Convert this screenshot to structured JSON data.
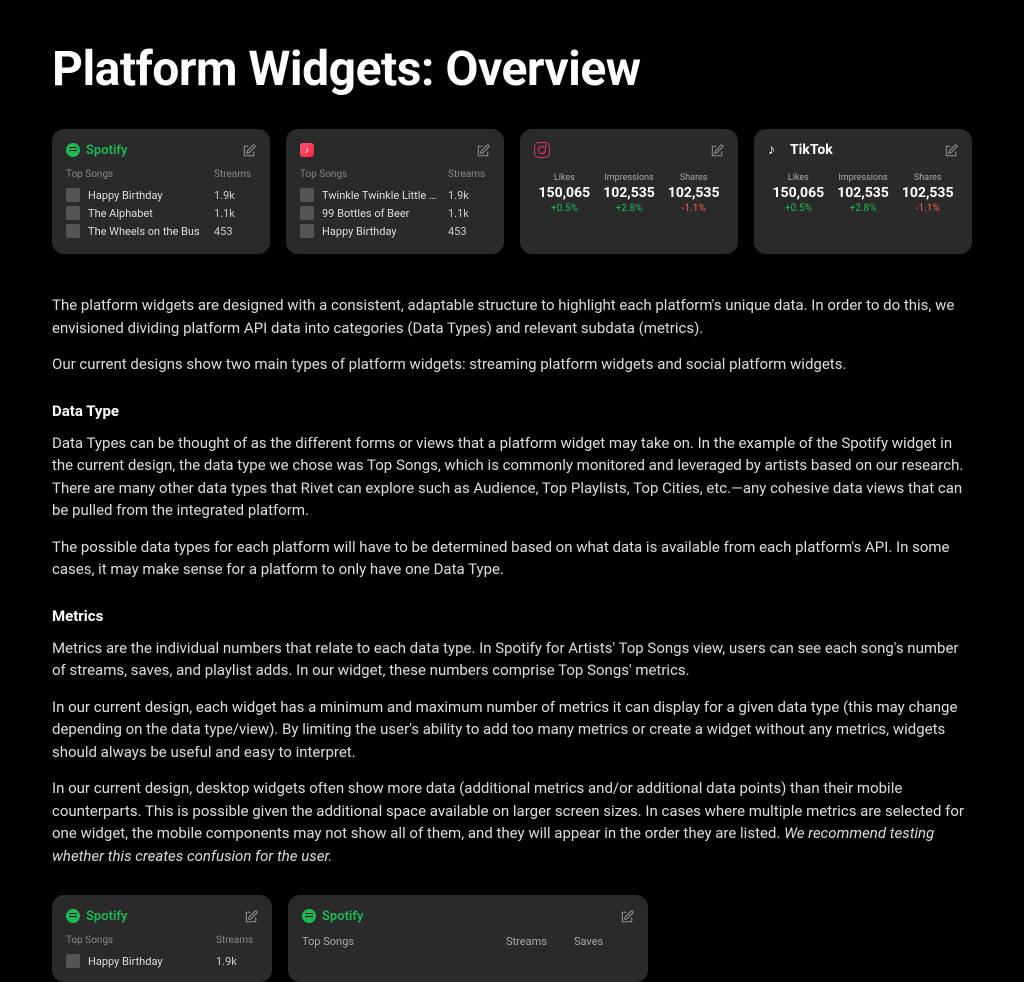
{
  "title": "Platform Widgets: Overview",
  "widgets": {
    "spotify": {
      "brand": "Spotify",
      "col_label": "Top Songs",
      "col_metric": "Streams",
      "songs": [
        {
          "name": "Happy Birthday",
          "value": "1.9k"
        },
        {
          "name": "The Alphabet",
          "value": "1.1k"
        },
        {
          "name": "The Wheels on the Bus",
          "value": "453"
        }
      ]
    },
    "apple": {
      "col_label": "Top Songs",
      "col_metric": "Streams",
      "songs": [
        {
          "name": "Twinkle Twinkle Little Star",
          "value": "1.9k"
        },
        {
          "name": "99 Bottles of Beer",
          "value": "1.1k"
        },
        {
          "name": "Happy Birthday",
          "value": "453"
        }
      ]
    },
    "instagram": {
      "metrics": [
        {
          "label": "Likes",
          "value": "150,065",
          "delta": "+0.5%",
          "dir": "pos"
        },
        {
          "label": "Impressions",
          "value": "102,535",
          "delta": "+2.8%",
          "dir": "pos"
        },
        {
          "label": "Shares",
          "value": "102,535",
          "delta": "-1.1%",
          "dir": "neg"
        }
      ]
    },
    "tiktok": {
      "brand": "TikTok",
      "metrics": [
        {
          "label": "Likes",
          "value": "150,065",
          "delta": "+0.5%",
          "dir": "pos"
        },
        {
          "label": "Impressions",
          "value": "102,535",
          "delta": "+2.8%",
          "dir": "pos"
        },
        {
          "label": "Shares",
          "value": "102,535",
          "delta": "-1.1%",
          "dir": "neg"
        }
      ]
    }
  },
  "intro": {
    "p1": "The platform widgets are designed with a consistent, adaptable structure to highlight each platform's unique data. In order to do this, we envisioned dividing platform API data into categories (Data Types) and relevant subdata (metrics).",
    "p2": "Our current designs show two main types of platform widgets: streaming platform widgets and social platform widgets."
  },
  "datatype": {
    "heading": "Data Type",
    "p1": "Data Types can be thought of as the different forms or views that a platform widget may take on. In the example of the Spotify widget in the current design, the data type we chose was Top Songs, which is commonly monitored and leveraged by artists based on our research. There are many other data types that Rivet can explore such as Audience, Top Playlists, Top Cities, etc.—any cohesive data views that can be pulled from the integrated platform.",
    "p2": "The possible data types for each platform will have to be determined based on what data is available from each platform's API. In some cases, it may make sense for a platform to only have one Data Type."
  },
  "metrics_section": {
    "heading": "Metrics",
    "p1": "Metrics are the individual numbers that relate to each data type. In Spotify for Artists' Top Songs view, users can see each song's number of streams, saves, and playlist adds. In our widget, these numbers comprise Top Songs' metrics.",
    "p2": "In our current design, each widget has a minimum and maximum number of metrics it can display for a given data type (this may change depending on the data type/view). By limiting the user's ability to add too many metrics or create a widget without any metrics, widgets should always be useful and easy to interpret.",
    "p3a": "In our current design, desktop widgets often show more data (additional metrics and/or additional data points) than their mobile counterparts. This is possible given the additional space available on larger screen sizes. In cases where multiple metrics are selected for one widget, the mobile components may not show all of them, and they will appear in the order they are listed. ",
    "p3b": "We recommend testing whether this creates confusion for the user."
  },
  "bottom_widgets": {
    "spotify_narrow": {
      "brand": "Spotify",
      "col_label": "Top Songs",
      "col_metric": "Streams",
      "song_name": "Happy Birthday",
      "song_value": "1.9k"
    },
    "spotify_wide": {
      "brand": "Spotify",
      "col_label": "Top Songs",
      "col_metric1": "Streams",
      "col_metric2": "Saves"
    }
  }
}
